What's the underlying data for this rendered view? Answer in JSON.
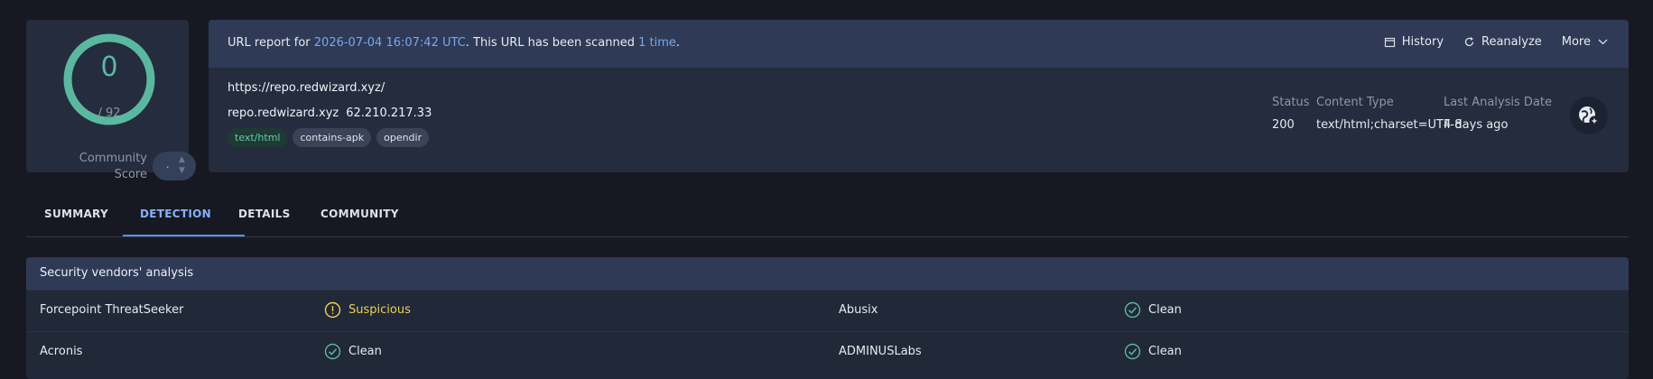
{
  "score": {
    "detections": "0",
    "total": "/ 92",
    "community_label_1": "Community",
    "community_label_2": "Score",
    "ring_color": "#5bb8a0",
    "vote_value": "·"
  },
  "report": {
    "prefix": "URL report for ",
    "date": "2026-07-04 16:07:42 UTC",
    "middle": ". This URL has been scanned ",
    "count": "1 time",
    "suffix": ".",
    "actions": {
      "history": "History",
      "reanalyze": "Reanalyze",
      "more": "More"
    },
    "url": "https://repo.redwizard.xyz/",
    "host": "repo.redwizard.xyz",
    "ip": "62.210.217.33",
    "tags": [
      "text/html",
      "contains-apk",
      "opendir"
    ],
    "meta": {
      "status_label": "Status",
      "status_value": "200",
      "content_type_label": "Content Type",
      "content_type_value": "text/html;charset=UTF-8",
      "last_analysis_label": "Last Analysis Date",
      "last_analysis_value": "4 days ago"
    }
  },
  "tabs": [
    "SUMMARY",
    "DETECTION",
    "DETAILS",
    "COMMUNITY"
  ],
  "active_tab": "DETECTION",
  "analysis": {
    "title": "Security vendors' analysis",
    "rows": [
      {
        "vendor1": "Forcepoint ThreatSeeker",
        "verdict1": "Suspicious",
        "vendor2": "Abusix",
        "verdict2": "Clean"
      },
      {
        "vendor1": "Acronis",
        "verdict1": "Clean",
        "vendor2": "ADMINUSLabs",
        "verdict2": "Clean"
      }
    ]
  },
  "colors": {
    "accent": "#7aa7f0",
    "clean": "#5bb8a0",
    "suspicious": "#f0cf52"
  }
}
